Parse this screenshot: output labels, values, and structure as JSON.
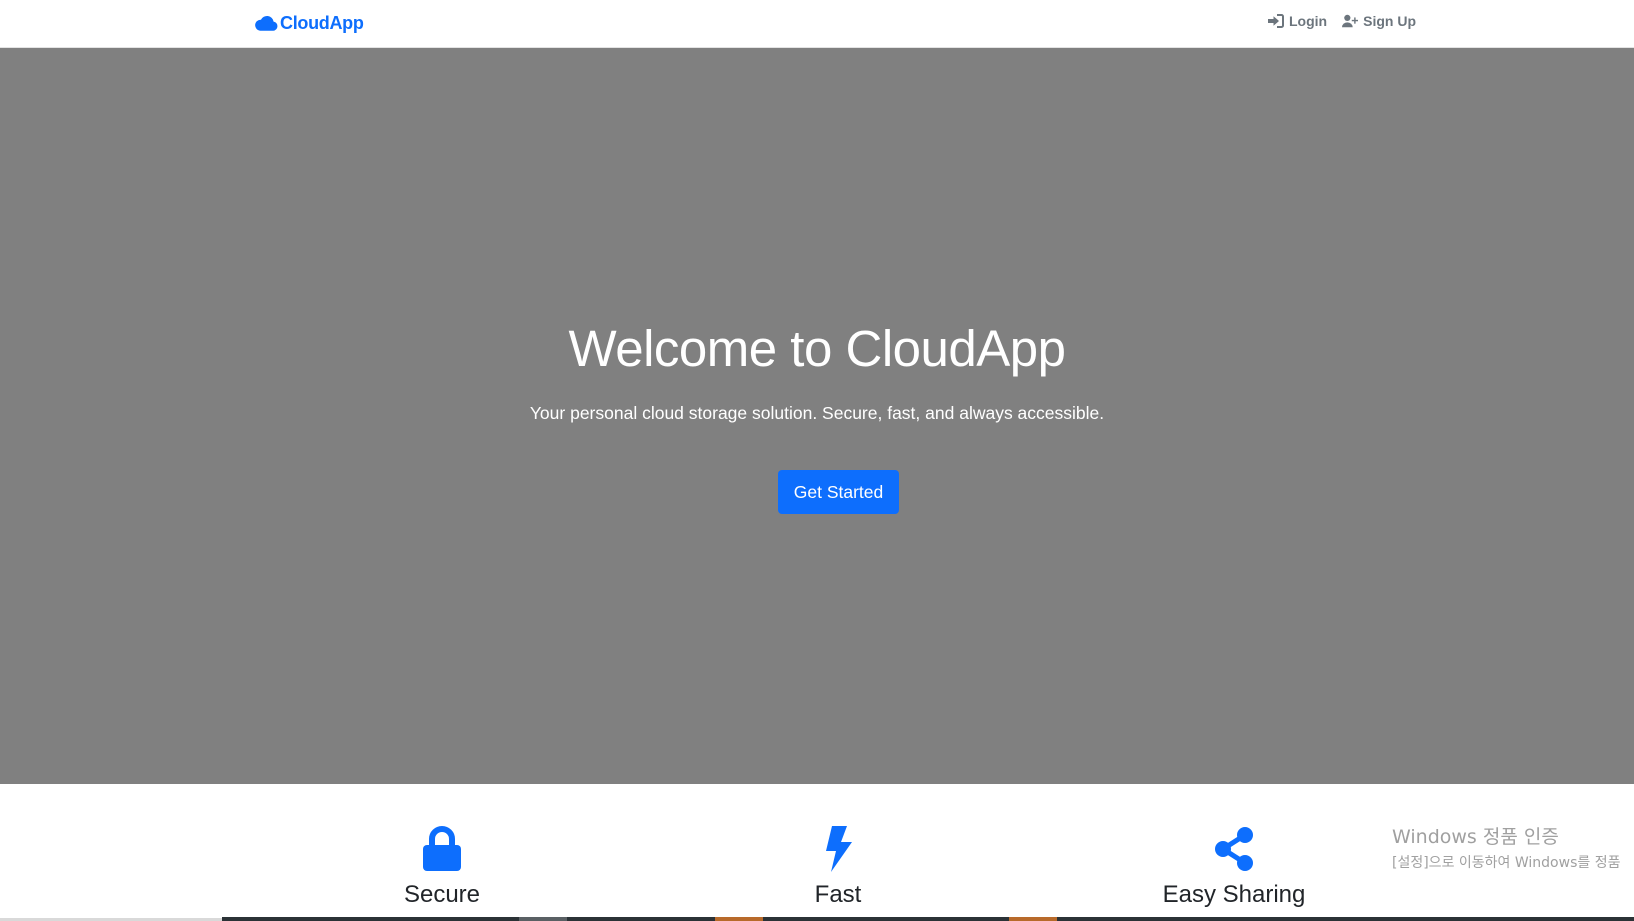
{
  "navbar": {
    "brand": "CloudApp",
    "login": "Login",
    "signup": "Sign Up"
  },
  "hero": {
    "title": "Welcome to CloudApp",
    "subtitle": "Your personal cloud storage solution. Secure, fast, and always accessible.",
    "cta": "Get Started"
  },
  "features": [
    {
      "title": "Secure",
      "icon": "lock-icon"
    },
    {
      "title": "Fast",
      "icon": "bolt-icon"
    },
    {
      "title": "Easy Sharing",
      "icon": "share-icon"
    }
  ],
  "watermark": {
    "title": "Windows 정품 인증",
    "subtitle": "[설정]으로 이동하여 Windows를 정품"
  },
  "colors": {
    "primary": "#0d6efd",
    "hero_bg": "#808080",
    "nav_text": "#6c757d"
  }
}
